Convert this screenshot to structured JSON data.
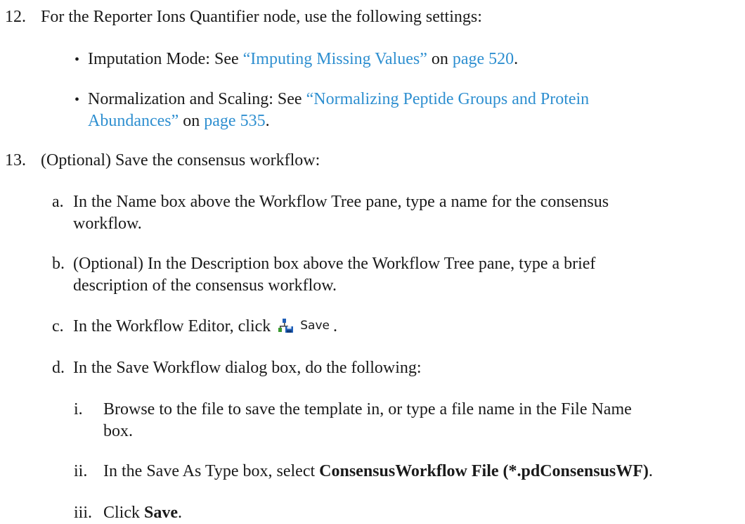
{
  "step12": {
    "number": "12.",
    "text": "For the Reporter Ions Quantifier node, use the following settings:",
    "bullets": [
      {
        "bullet": "•",
        "label": "Imputation Mode: See ",
        "link": "“Imputing Missing Values”",
        "on": " on ",
        "page_link": "page 520",
        "end": "."
      },
      {
        "bullet": "•",
        "label": "Normalization and Scaling: See ",
        "link_line1": "“Normalizing Peptide Groups and Protein",
        "link_line2": "Abundances”",
        "on": " on ",
        "page_link": "page 535",
        "end": "."
      }
    ]
  },
  "step13": {
    "number": "13.",
    "text": "(Optional) Save the consensus workflow:",
    "a": {
      "marker": "a.",
      "line1": "In the Name box above the Workflow Tree pane, type a name for the consensus",
      "line2": "workflow."
    },
    "b": {
      "marker": "b.",
      "line1": "(Optional) In the Description box above the Workflow Tree pane, type a brief",
      "line2": "description of the consensus workflow."
    },
    "c": {
      "marker": "c.",
      "text": "In the Workflow Editor, click ",
      "button_label": "Save",
      "button_icon": "save-workflow-icon",
      "end": "."
    },
    "d": {
      "marker": "d.",
      "text": "In the Save Workflow dialog box, do the following:",
      "i": {
        "marker": "i.",
        "line1": "Browse to the file to save the template in, or type a file name in the File Name",
        "line2": "box."
      },
      "ii": {
        "marker": "ii.",
        "text": "In the Save As Type box, select ",
        "bold": "ConsensusWorkflow File (*.pdConsensusWF)",
        "end": "."
      },
      "iii": {
        "marker": "iii.",
        "text": "Click ",
        "bold": "Save",
        "end": "."
      }
    }
  },
  "colors": {
    "text": "#1a1a1a",
    "link": "#2e8fd0",
    "icon_blue": "#1f5fb8",
    "icon_green": "#3a9a2f"
  }
}
